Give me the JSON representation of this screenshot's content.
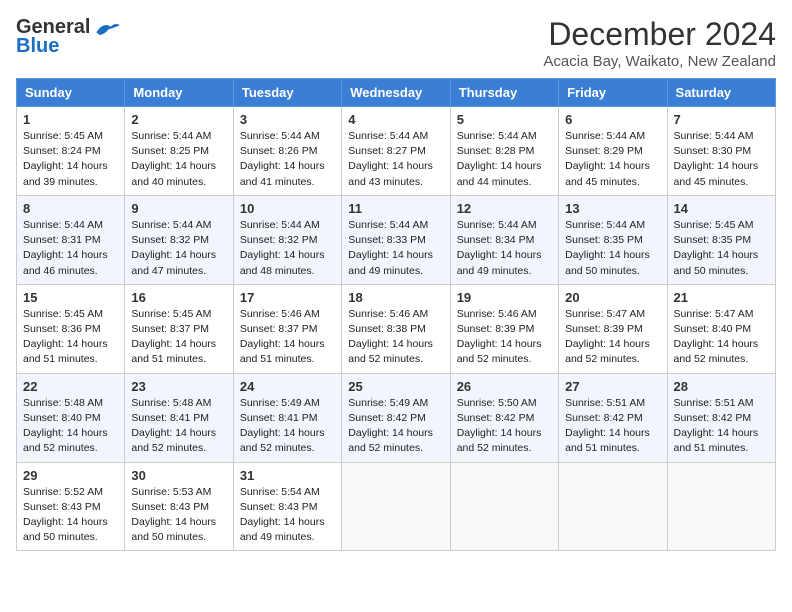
{
  "logo": {
    "general": "General",
    "blue": "Blue"
  },
  "title": "December 2024",
  "location": "Acacia Bay, Waikato, New Zealand",
  "days_header": [
    "Sunday",
    "Monday",
    "Tuesday",
    "Wednesday",
    "Thursday",
    "Friday",
    "Saturday"
  ],
  "weeks": [
    [
      {
        "day": "1",
        "info": "Sunrise: 5:45 AM\nSunset: 8:24 PM\nDaylight: 14 hours\nand 39 minutes."
      },
      {
        "day": "2",
        "info": "Sunrise: 5:44 AM\nSunset: 8:25 PM\nDaylight: 14 hours\nand 40 minutes."
      },
      {
        "day": "3",
        "info": "Sunrise: 5:44 AM\nSunset: 8:26 PM\nDaylight: 14 hours\nand 41 minutes."
      },
      {
        "day": "4",
        "info": "Sunrise: 5:44 AM\nSunset: 8:27 PM\nDaylight: 14 hours\nand 43 minutes."
      },
      {
        "day": "5",
        "info": "Sunrise: 5:44 AM\nSunset: 8:28 PM\nDaylight: 14 hours\nand 44 minutes."
      },
      {
        "day": "6",
        "info": "Sunrise: 5:44 AM\nSunset: 8:29 PM\nDaylight: 14 hours\nand 45 minutes."
      },
      {
        "day": "7",
        "info": "Sunrise: 5:44 AM\nSunset: 8:30 PM\nDaylight: 14 hours\nand 45 minutes."
      }
    ],
    [
      {
        "day": "8",
        "info": "Sunrise: 5:44 AM\nSunset: 8:31 PM\nDaylight: 14 hours\nand 46 minutes."
      },
      {
        "day": "9",
        "info": "Sunrise: 5:44 AM\nSunset: 8:32 PM\nDaylight: 14 hours\nand 47 minutes."
      },
      {
        "day": "10",
        "info": "Sunrise: 5:44 AM\nSunset: 8:32 PM\nDaylight: 14 hours\nand 48 minutes."
      },
      {
        "day": "11",
        "info": "Sunrise: 5:44 AM\nSunset: 8:33 PM\nDaylight: 14 hours\nand 49 minutes."
      },
      {
        "day": "12",
        "info": "Sunrise: 5:44 AM\nSunset: 8:34 PM\nDaylight: 14 hours\nand 49 minutes."
      },
      {
        "day": "13",
        "info": "Sunrise: 5:44 AM\nSunset: 8:35 PM\nDaylight: 14 hours\nand 50 minutes."
      },
      {
        "day": "14",
        "info": "Sunrise: 5:45 AM\nSunset: 8:35 PM\nDaylight: 14 hours\nand 50 minutes."
      }
    ],
    [
      {
        "day": "15",
        "info": "Sunrise: 5:45 AM\nSunset: 8:36 PM\nDaylight: 14 hours\nand 51 minutes."
      },
      {
        "day": "16",
        "info": "Sunrise: 5:45 AM\nSunset: 8:37 PM\nDaylight: 14 hours\nand 51 minutes."
      },
      {
        "day": "17",
        "info": "Sunrise: 5:46 AM\nSunset: 8:37 PM\nDaylight: 14 hours\nand 51 minutes."
      },
      {
        "day": "18",
        "info": "Sunrise: 5:46 AM\nSunset: 8:38 PM\nDaylight: 14 hours\nand 52 minutes."
      },
      {
        "day": "19",
        "info": "Sunrise: 5:46 AM\nSunset: 8:39 PM\nDaylight: 14 hours\nand 52 minutes."
      },
      {
        "day": "20",
        "info": "Sunrise: 5:47 AM\nSunset: 8:39 PM\nDaylight: 14 hours\nand 52 minutes."
      },
      {
        "day": "21",
        "info": "Sunrise: 5:47 AM\nSunset: 8:40 PM\nDaylight: 14 hours\nand 52 minutes."
      }
    ],
    [
      {
        "day": "22",
        "info": "Sunrise: 5:48 AM\nSunset: 8:40 PM\nDaylight: 14 hours\nand 52 minutes."
      },
      {
        "day": "23",
        "info": "Sunrise: 5:48 AM\nSunset: 8:41 PM\nDaylight: 14 hours\nand 52 minutes."
      },
      {
        "day": "24",
        "info": "Sunrise: 5:49 AM\nSunset: 8:41 PM\nDaylight: 14 hours\nand 52 minutes."
      },
      {
        "day": "25",
        "info": "Sunrise: 5:49 AM\nSunset: 8:42 PM\nDaylight: 14 hours\nand 52 minutes."
      },
      {
        "day": "26",
        "info": "Sunrise: 5:50 AM\nSunset: 8:42 PM\nDaylight: 14 hours\nand 52 minutes."
      },
      {
        "day": "27",
        "info": "Sunrise: 5:51 AM\nSunset: 8:42 PM\nDaylight: 14 hours\nand 51 minutes."
      },
      {
        "day": "28",
        "info": "Sunrise: 5:51 AM\nSunset: 8:42 PM\nDaylight: 14 hours\nand 51 minutes."
      }
    ],
    [
      {
        "day": "29",
        "info": "Sunrise: 5:52 AM\nSunset: 8:43 PM\nDaylight: 14 hours\nand 50 minutes."
      },
      {
        "day": "30",
        "info": "Sunrise: 5:53 AM\nSunset: 8:43 PM\nDaylight: 14 hours\nand 50 minutes."
      },
      {
        "day": "31",
        "info": "Sunrise: 5:54 AM\nSunset: 8:43 PM\nDaylight: 14 hours\nand 49 minutes."
      },
      {
        "day": "",
        "info": ""
      },
      {
        "day": "",
        "info": ""
      },
      {
        "day": "",
        "info": ""
      },
      {
        "day": "",
        "info": ""
      }
    ]
  ]
}
